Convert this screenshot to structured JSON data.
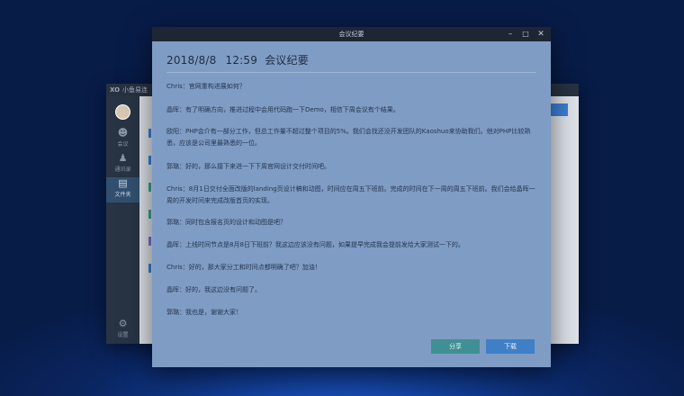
{
  "background_app": {
    "title": "小鱼易连",
    "nav": [
      {
        "label": "会议",
        "icon": "people-icon"
      },
      {
        "label": "通讯录",
        "icon": "contacts-icon"
      },
      {
        "label": "文件夹",
        "icon": "folder-icon"
      }
    ],
    "settings_label": "设置"
  },
  "modal": {
    "window_title": "会议纪要",
    "date": "2018/8/8",
    "time": "12:59",
    "title": "会议纪要",
    "notes": [
      "Chris：官网重构进展如何？",
      "晶晖：有了明确方向，推进过程中会用代码跑一下Demo，相信下周会议有个结果。",
      "欧阳：PHP会介有一部分工作，但总工作量不超过整个项目的5%。我们会找还没开发团队的Kaoshuo来协助我们。他对PHP比较熟悉，应该是公司里最熟悉的一位。",
      "郭璐：好的，那么接下来进一下下周官网设计交付时间吧。",
      "Chris：8月1日交付全面改版的landing页设计稿和动图，时间应在周五下班前。完成的时间在下一周的周五下班前。我们会给晶晖一周的开发时间来完成改版首页的实现。",
      "郭璐：同时包含报名页的设计和动图是吧？",
      "晶晖：上线时间节点是8月8日下班前？我这边应该没有问题，如果提早完成我会提前发给大家测试一下的。",
      "Chris：好的，那大家分工和时间点都明确了吧？加油！",
      "晶晖：好的，我这边没有问题了。",
      "郭璐：我也是，谢谢大家！"
    ],
    "share_label": "分享",
    "download_label": "下载"
  },
  "colors": {
    "modal_bg": "#7f9cc4",
    "titlebar": "#1d2634",
    "share_button": "#3f8f93",
    "download_button": "#3f7fc8"
  }
}
